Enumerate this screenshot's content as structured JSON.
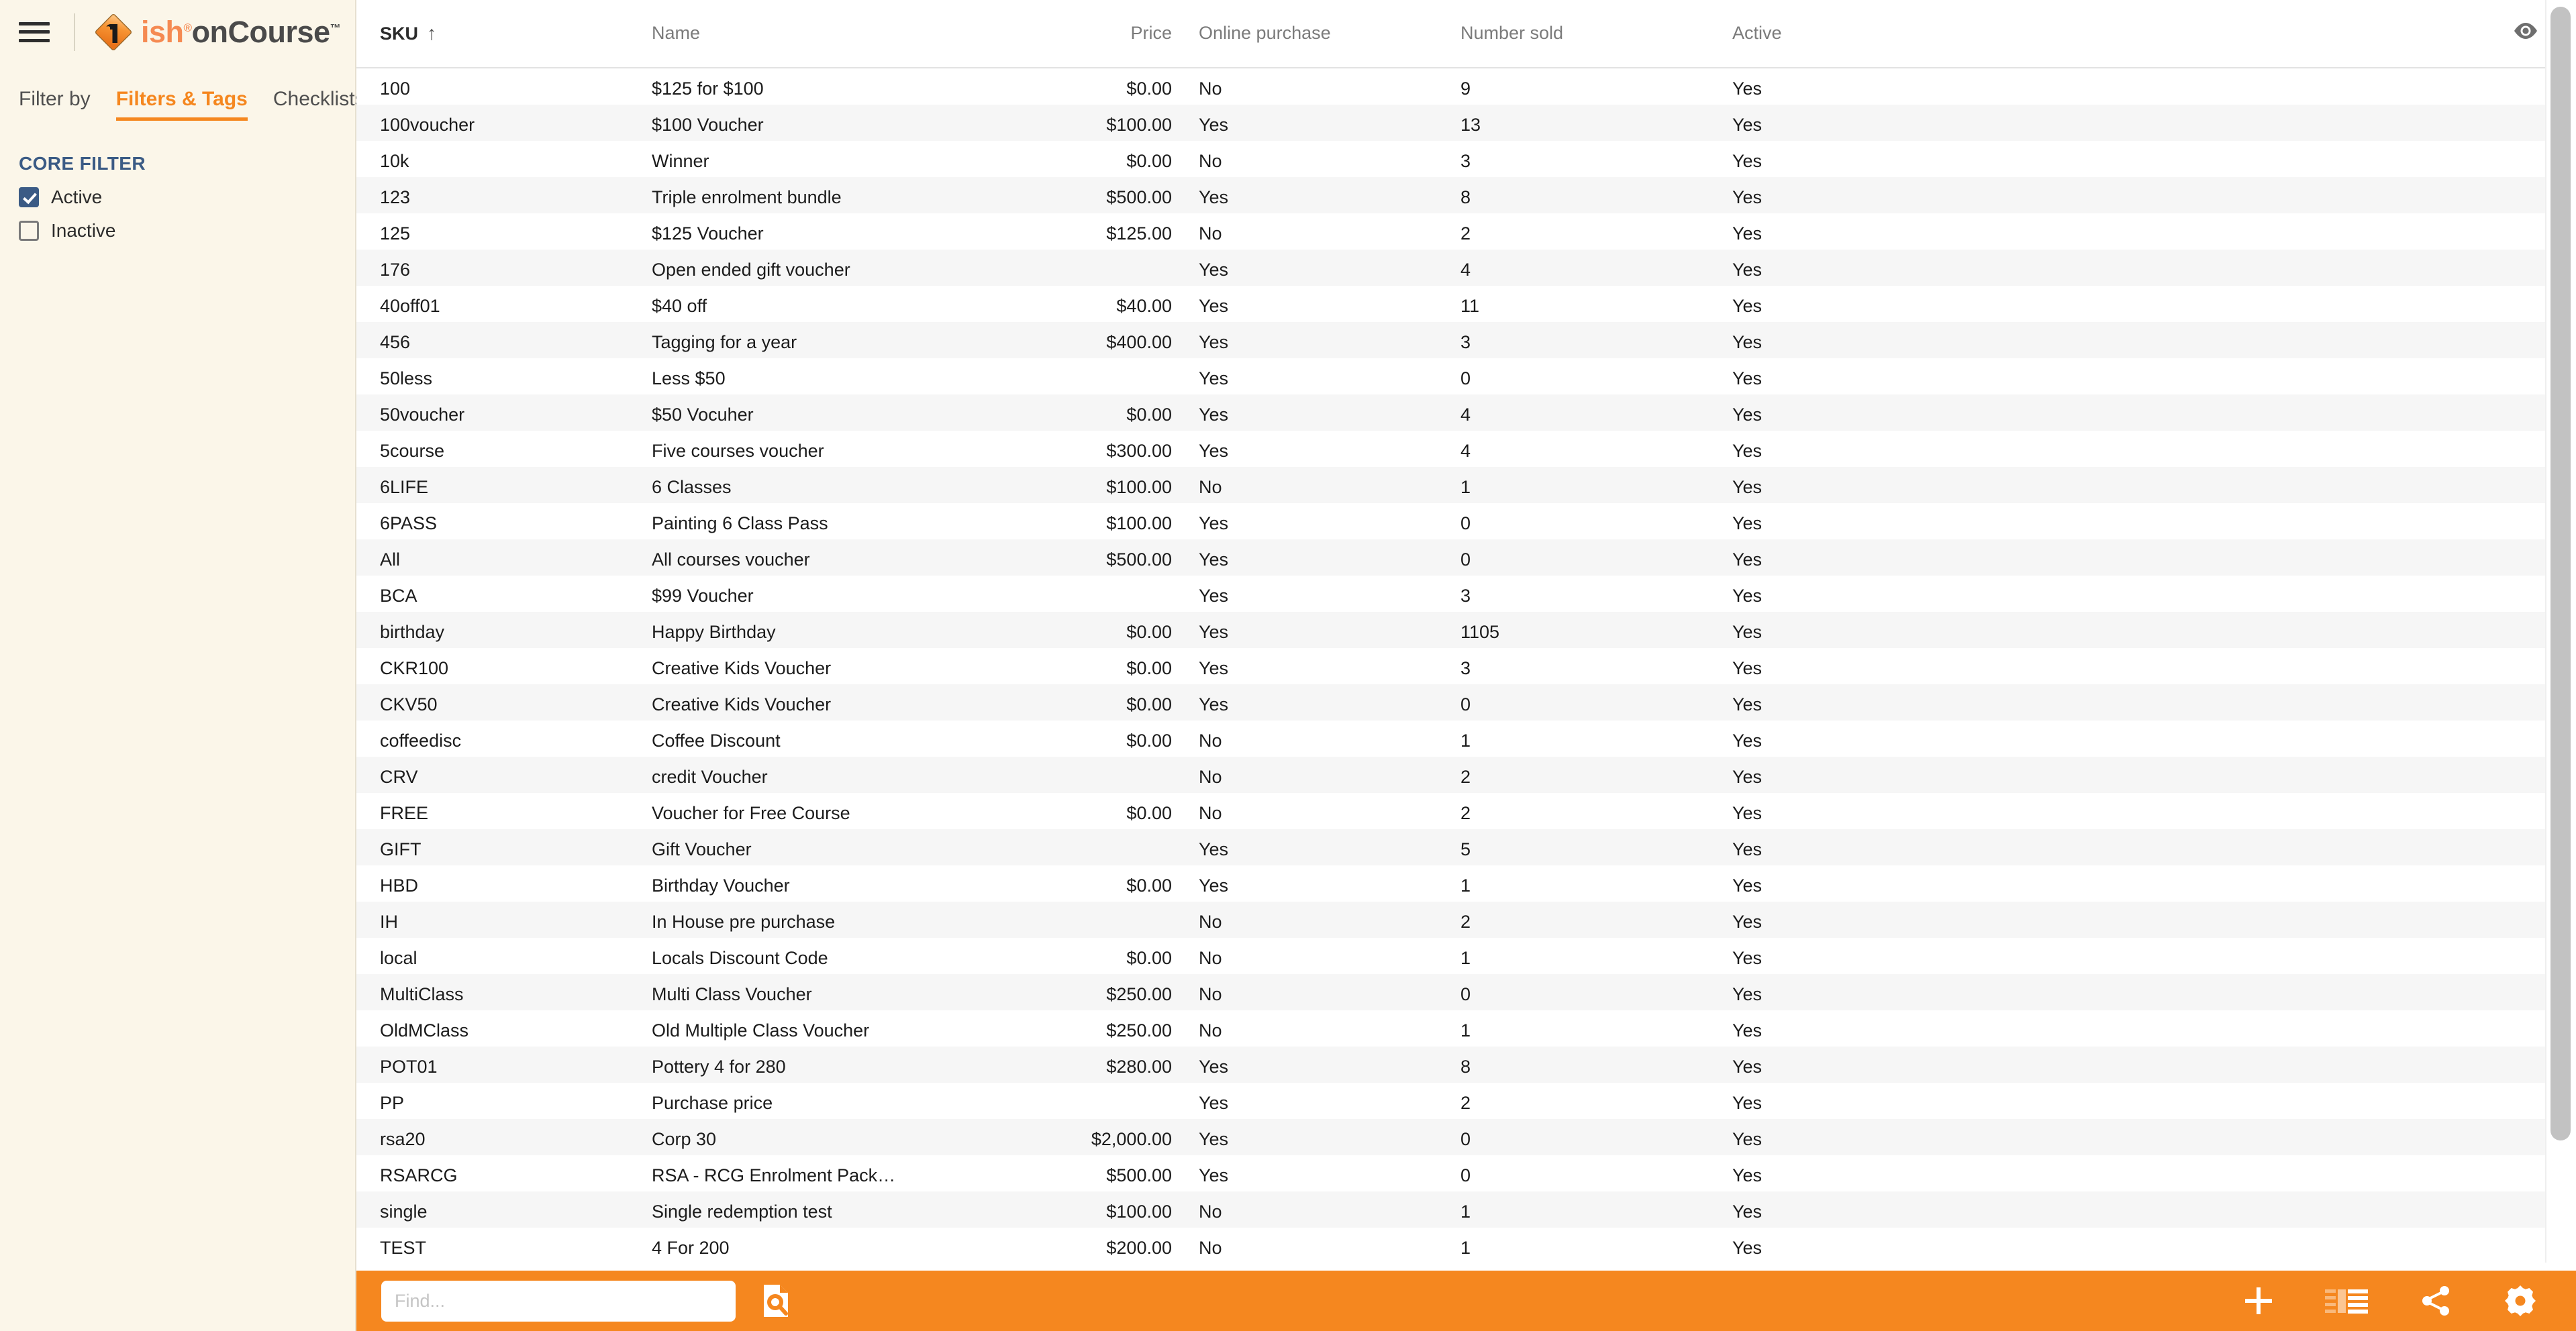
{
  "theme": {
    "accent": "#f5871f",
    "sidebar_bg": "#fbf6e9",
    "heading_blue": "#3b5b85",
    "row_alt": "#f6f6f6"
  },
  "sidebar": {
    "menu_icon": "hamburger-menu-icon",
    "logo": {
      "mark": "ish-diamond-logo-icon",
      "text_primary": "ish",
      "registered": "®",
      "text_secondary": "onCourse",
      "trademark": "™"
    },
    "tabs": [
      {
        "label": "Filter by",
        "active": false
      },
      {
        "label": "Filters & Tags",
        "active": true
      },
      {
        "label": "Checklists",
        "active": false
      }
    ],
    "core_filter": {
      "title": "CORE FILTER",
      "options": [
        {
          "label": "Active",
          "checked": true
        },
        {
          "label": "Inactive",
          "checked": false
        }
      ]
    }
  },
  "table": {
    "sort_column": "SKU",
    "sort_direction": "ascending",
    "sort_arrow": "↑",
    "visibility_icon": "eye-icon",
    "columns": [
      {
        "key": "sku",
        "label": "SKU",
        "align": "left",
        "sorted": true
      },
      {
        "key": "name",
        "label": "Name",
        "align": "left",
        "sorted": false
      },
      {
        "key": "price",
        "label": "Price",
        "align": "right",
        "sorted": false
      },
      {
        "key": "online",
        "label": "Online purchase",
        "align": "left",
        "sorted": false
      },
      {
        "key": "sold",
        "label": "Number sold",
        "align": "left",
        "sorted": false
      },
      {
        "key": "active",
        "label": "Active",
        "align": "left",
        "sorted": false
      }
    ],
    "rows": [
      {
        "sku": "100",
        "name": "$125 for $100",
        "price": "$0.00",
        "online": "No",
        "sold": "9",
        "active": "Yes"
      },
      {
        "sku": "100voucher",
        "name": "$100 Voucher",
        "price": "$100.00",
        "online": "Yes",
        "sold": "13",
        "active": "Yes"
      },
      {
        "sku": "10k",
        "name": "Winner",
        "price": "$0.00",
        "online": "No",
        "sold": "3",
        "active": "Yes"
      },
      {
        "sku": "123",
        "name": "Triple enrolment bundle",
        "price": "$500.00",
        "online": "Yes",
        "sold": "8",
        "active": "Yes"
      },
      {
        "sku": "125",
        "name": "$125 Voucher",
        "price": "$125.00",
        "online": "No",
        "sold": "2",
        "active": "Yes"
      },
      {
        "sku": "176",
        "name": "Open ended gift voucher",
        "price": "",
        "online": "Yes",
        "sold": "4",
        "active": "Yes"
      },
      {
        "sku": "40off01",
        "name": "$40 off",
        "price": "$40.00",
        "online": "Yes",
        "sold": "11",
        "active": "Yes"
      },
      {
        "sku": "456",
        "name": "Tagging for a year",
        "price": "$400.00",
        "online": "Yes",
        "sold": "3",
        "active": "Yes"
      },
      {
        "sku": "50less",
        "name": "Less $50",
        "price": "",
        "online": "Yes",
        "sold": "0",
        "active": "Yes"
      },
      {
        "sku": "50voucher",
        "name": "$50 Vocuher",
        "price": "$0.00",
        "online": "Yes",
        "sold": "4",
        "active": "Yes"
      },
      {
        "sku": "5course",
        "name": "Five courses voucher",
        "price": "$300.00",
        "online": "Yes",
        "sold": "4",
        "active": "Yes"
      },
      {
        "sku": "6LIFE",
        "name": "6 Classes",
        "price": "$100.00",
        "online": "No",
        "sold": "1",
        "active": "Yes"
      },
      {
        "sku": "6PASS",
        "name": "Painting 6 Class Pass",
        "price": "$100.00",
        "online": "Yes",
        "sold": "0",
        "active": "Yes"
      },
      {
        "sku": "All",
        "name": "All courses voucher",
        "price": "$500.00",
        "online": "Yes",
        "sold": "0",
        "active": "Yes"
      },
      {
        "sku": "BCA",
        "name": "$99 Voucher",
        "price": "",
        "online": "Yes",
        "sold": "3",
        "active": "Yes"
      },
      {
        "sku": "birthday",
        "name": "Happy Birthday",
        "price": "$0.00",
        "online": "Yes",
        "sold": "1105",
        "active": "Yes"
      },
      {
        "sku": "CKR100",
        "name": "Creative Kids Voucher",
        "price": "$0.00",
        "online": "Yes",
        "sold": "3",
        "active": "Yes"
      },
      {
        "sku": "CKV50",
        "name": "Creative Kids Voucher",
        "price": "$0.00",
        "online": "Yes",
        "sold": "0",
        "active": "Yes"
      },
      {
        "sku": "coffeedisc",
        "name": "Coffee Discount",
        "price": "$0.00",
        "online": "No",
        "sold": "1",
        "active": "Yes"
      },
      {
        "sku": "CRV",
        "name": "credit Voucher",
        "price": "",
        "online": "No",
        "sold": "2",
        "active": "Yes"
      },
      {
        "sku": "FREE",
        "name": "Voucher for Free Course",
        "price": "$0.00",
        "online": "No",
        "sold": "2",
        "active": "Yes"
      },
      {
        "sku": "GIFT",
        "name": "Gift Voucher",
        "price": "",
        "online": "Yes",
        "sold": "5",
        "active": "Yes"
      },
      {
        "sku": "HBD",
        "name": "Birthday Voucher",
        "price": "$0.00",
        "online": "Yes",
        "sold": "1",
        "active": "Yes"
      },
      {
        "sku": "IH",
        "name": "In House pre purchase",
        "price": "",
        "online": "No",
        "sold": "2",
        "active": "Yes"
      },
      {
        "sku": "local",
        "name": "Locals Discount Code",
        "price": "$0.00",
        "online": "No",
        "sold": "1",
        "active": "Yes"
      },
      {
        "sku": "MultiClass",
        "name": "Multi Class Voucher",
        "price": "$250.00",
        "online": "No",
        "sold": "0",
        "active": "Yes"
      },
      {
        "sku": "OldMClass",
        "name": "Old Multiple Class Voucher",
        "price": "$250.00",
        "online": "No",
        "sold": "1",
        "active": "Yes"
      },
      {
        "sku": "POT01",
        "name": "Pottery 4 for 280",
        "price": "$280.00",
        "online": "Yes",
        "sold": "8",
        "active": "Yes"
      },
      {
        "sku": "PP",
        "name": "Purchase price",
        "price": "",
        "online": "Yes",
        "sold": "2",
        "active": "Yes"
      },
      {
        "sku": "rsa20",
        "name": "Corp 30",
        "price": "$2,000.00",
        "online": "Yes",
        "sold": "0",
        "active": "Yes"
      },
      {
        "sku": "RSARCG",
        "name": "RSA - RCG Enrolment Pack…",
        "price": "$500.00",
        "online": "Yes",
        "sold": "0",
        "active": "Yes"
      },
      {
        "sku": "single",
        "name": "Single redemption test",
        "price": "$100.00",
        "online": "No",
        "sold": "1",
        "active": "Yes"
      },
      {
        "sku": "TEST",
        "name": "4 For 200",
        "price": "$200.00",
        "online": "No",
        "sold": "1",
        "active": "Yes"
      }
    ]
  },
  "bottom_bar": {
    "find_placeholder": "Find...",
    "find_value": "",
    "saved_search_icon": "document-search-icon",
    "actions": [
      {
        "name": "add-button",
        "icon": "plus-icon"
      },
      {
        "name": "layout-button",
        "icon": "columns-layout-icon"
      },
      {
        "name": "share-button",
        "icon": "share-icon"
      },
      {
        "name": "settings-button",
        "icon": "gear-icon"
      }
    ]
  }
}
